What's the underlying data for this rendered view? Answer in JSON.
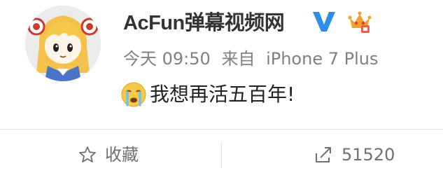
{
  "post": {
    "username": "AcFun弹幕视频网",
    "time": "今天 09:50",
    "source_prefix": "来自",
    "source_device": "iPhone 7 Plus",
    "text": "我想再活五百年!"
  },
  "actions": {
    "favorite_label": "收藏",
    "repost_count": "51520"
  },
  "colors": {
    "verified": "#2f8de4",
    "vip_crown": "#f3a12a",
    "meta": "#808080"
  },
  "icons": {
    "avatar": "anime-girl-avatar",
    "verified": "verified-v-icon",
    "vip": "vip-crown-icon",
    "emoji": "crying-face-emoji",
    "favorite": "star-icon",
    "repost": "repost-icon"
  }
}
